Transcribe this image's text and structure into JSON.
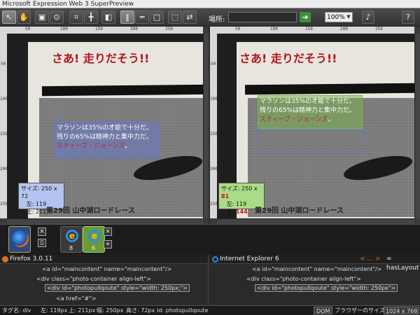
{
  "window": {
    "title": "Microsoft Expression Web 3 SuperPreview"
  },
  "toolbar": {
    "address_label": "場所:",
    "address_value": "",
    "zoom": "100%",
    "go_icon": "arrow-right-icon",
    "help_icon": "help-icon"
  },
  "left_page": {
    "title": "さあ! 走りだそう!!",
    "pull_lines": [
      "マラソンは35%の才能で十分だ。",
      "残りの65%は精神力と集中力だ。"
    ],
    "pull_link": "スティーブ・ジョーンズ",
    "pull_period": "。",
    "caption": "第29回 山中湖ロードレース",
    "info": {
      "size_label": "サイズ: ",
      "size": "250 x 72",
      "left_label": "左: ",
      "left": "119",
      "top_label": "上: ",
      "top": "211"
    }
  },
  "right_page": {
    "title": "さあ! 走りだそう!!",
    "pull_lines": [
      "マラソンは35%の才能で十分だ。",
      "残りの65%は精神力と集中力だ。"
    ],
    "pull_link": "スティーブ・ジョーンズ",
    "pull_period": "。",
    "caption": "第29回 山中湖ロードレース",
    "info": {
      "size_label": "サイズ: ",
      "size_w": "250 x ",
      "size_h": "81",
      "left_label": "左: ",
      "left": "119",
      "top_label": "上: ",
      "top": "144"
    }
  },
  "rulers": {
    "h_left": [
      "50",
      "100",
      "150",
      "200",
      "250"
    ],
    "h_right": [
      "50",
      "100",
      "150",
      "200",
      "250"
    ],
    "v": [
      "50",
      "100",
      "150",
      "200",
      "250"
    ]
  },
  "browsers": {
    "baseline": {
      "name": "Firefox 3.0.11"
    },
    "compare": [
      {
        "version": "8"
      },
      {
        "version": "6"
      }
    ],
    "close_label": "×",
    "add_label": "+"
  },
  "dom_left": {
    "header": "Firefox 3.0.11",
    "lines": [
      "<a id=\"maincontent\" name=\"maincontent\"/>",
      "<div class=\"photo-container align-left\">",
      "<div id=\"photopullqoute\" style=\"width: 250px;\">",
      "<a href=\"#\">"
    ]
  },
  "dom_right": {
    "header": "Internet Explorer 6",
    "nav": "< ... >",
    "haslayout": "= hasLayout",
    "lines": [
      "<a id=\"maincontent\" name=\"maincontent\"/>",
      "<div class=\"photo-container align-left\">",
      "<div id=\"photopullqoute\" style=\"width: 250px\">"
    ]
  },
  "status": {
    "tag": "タグ名: div",
    "left": "左: 119px",
    "top": "上: 211px",
    "width": "幅: 250px",
    "height": "高さ: 72px",
    "id": "Id: photopullqoute",
    "dom_button": "DOM",
    "browser_size_label": "ブラウザーのサイズ:",
    "browser_size": "1024 x 768"
  },
  "colors": {
    "accent_red": "#b4121e",
    "left_highlight": "#6a78c8",
    "right_highlight": "#7ab84a"
  }
}
